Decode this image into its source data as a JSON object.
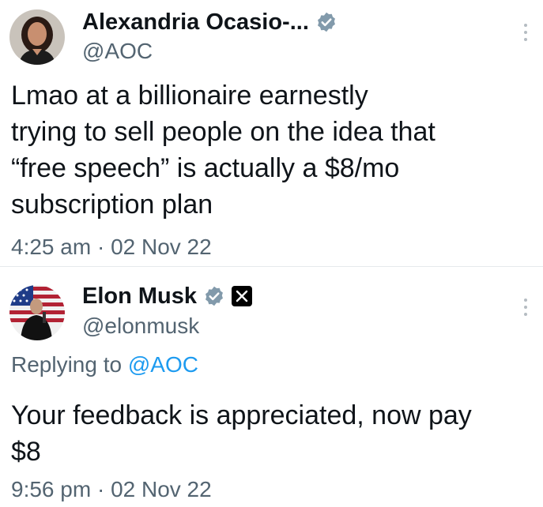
{
  "tweets": [
    {
      "name": "Alexandria Ocasio-...",
      "handle": "@AOC",
      "verified": true,
      "avatar_icon": "profile-photo",
      "text_lines": [
        "Lmao at a billionaire earnestly",
        "trying to sell people on the idea that",
        "“free speech” is actually a $8/mo",
        "subscription plan"
      ],
      "time": "4:25 am",
      "separator": "·",
      "date": "02 Nov 22"
    },
    {
      "name": "Elon Musk",
      "handle": "@elonmusk",
      "verified": true,
      "affiliate_badge": "x-logo",
      "avatar_icon": "profile-photo",
      "replying_prefix": "Replying to",
      "replying_mention": "@AOC",
      "text_lines": [
        "Your feedback is appreciated, now pay",
        "$8"
      ],
      "time": "9:56 pm",
      "separator": "·",
      "date": "02 Nov 22"
    }
  ],
  "colors": {
    "text": "#0f1419",
    "secondary": "#536471",
    "link": "#1d9bf0",
    "verified_badge": "#829aab",
    "divider": "#e6e9ec"
  }
}
